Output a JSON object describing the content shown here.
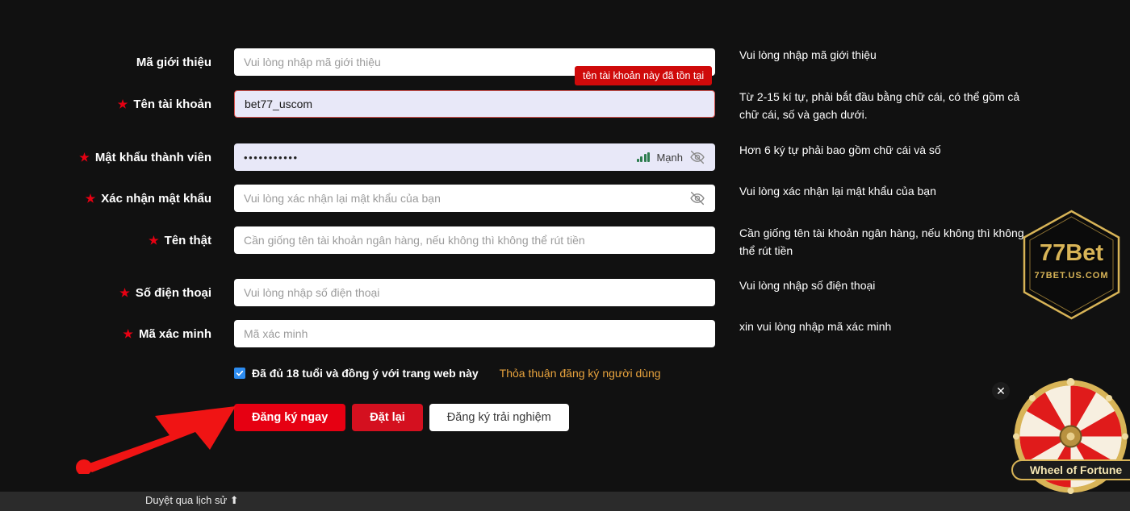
{
  "colors": {
    "background": "#111111",
    "accent_red": "#e60012",
    "error_red": "#cf0a0a",
    "gold": "#d8b457",
    "link_orange": "#e8a33d",
    "checkbox_blue": "#2d8cf0",
    "strength_green": "#2e7d4f",
    "field_white": "#ffffff",
    "field_filled": "#e8e8f8"
  },
  "tooltip": {
    "text": "tên tài khoản này đã tồn tại"
  },
  "form": {
    "rows": [
      {
        "label": "Mã giới thiệu",
        "required": false,
        "placeholder": "Vui lòng nhập mã giới thiệu",
        "value": "",
        "hint": "Vui lòng nhập mã giới thiệu"
      },
      {
        "label": "Tên tài khoản",
        "required": true,
        "placeholder": "",
        "value": "bet77_uscom",
        "hint": "Từ 2-15 kí tự, phải bắt đầu bằng chữ cái, có thể gồm cả chữ cái, số và gạch dưới."
      },
      {
        "label": "Mật khẩu thành viên",
        "required": true,
        "placeholder": "",
        "value": "•••••••••••",
        "hint": "Hơn 6 ký tự phải bao gồm chữ cái và số",
        "strength_label": "Mạnh"
      },
      {
        "label": "Xác nhận mật khẩu",
        "required": true,
        "placeholder": "Vui lòng xác nhận lại mật khẩu của bạn",
        "value": "",
        "hint": "Vui lòng xác nhận lại mật khẩu của bạn"
      },
      {
        "label": "Tên thật",
        "required": true,
        "placeholder": "Cần giống tên tài khoản ngân hàng, nếu không thì không thể rút tiền",
        "value": "",
        "hint": "Cần giống tên tài khoản ngân hàng, nếu không thì không thể rút tiền"
      },
      {
        "label": "Số điện thoại",
        "required": true,
        "placeholder": "Vui lòng nhập số điện thoại",
        "value": "",
        "hint": "Vui lòng nhập số điện thoại"
      },
      {
        "label": "Mã xác minh",
        "required": true,
        "placeholder": "Mã xác minh",
        "value": "",
        "hint": "xin vui lòng nhập mã xác minh"
      }
    ]
  },
  "agreement": {
    "checked": true,
    "text": "Đã đủ 18 tuổi và đồng ý với trang web này",
    "link": "Thỏa thuận đăng ký người dùng"
  },
  "buttons": {
    "register": "Đăng ký ngay",
    "reset": "Đặt lại",
    "trial": "Đăng ký trải nghiệm"
  },
  "logo": {
    "main": "77Bet",
    "sub": "77BET.US.COM"
  },
  "wheel": {
    "label": "Wheel of Fortune",
    "close": "✕"
  },
  "statusbar": {
    "text": "Duyệt qua lịch sử ⬆"
  }
}
